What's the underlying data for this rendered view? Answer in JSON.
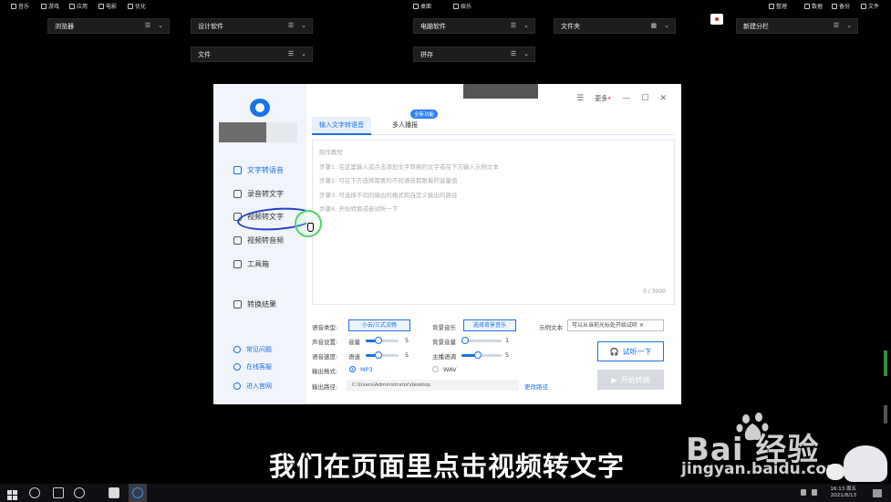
{
  "topbar": {
    "left_items": [
      "音乐",
      "游戏",
      "应用",
      "电影",
      "优化"
    ],
    "center_items": [
      "桌面",
      "娱乐"
    ],
    "right_items": [
      "整理",
      "数据",
      "备份",
      "文件"
    ]
  },
  "desktop_folders": [
    "浏览器",
    "设计软件",
    "电脑软件",
    "文件夹",
    "新建分栏",
    "文件",
    "拼存"
  ],
  "app": {
    "window": {
      "more_label": "更多",
      "dot": "•"
    },
    "sidebar": {
      "items": [
        "文字转语音",
        "录音转文字",
        "视频转文字",
        "视频转音频",
        "工具箱",
        "转换结果"
      ],
      "links": [
        "常见问题",
        "在线客服",
        "进入官网"
      ]
    },
    "tabs": [
      "输入文字转语音",
      "多人播报"
    ],
    "tab_badge": "全新功能",
    "textarea": {
      "lines": [
        "制作教程",
        "步骤1: 在这里输入或点击添加文字转换的文字或在下方输入示例文本",
        "步骤2: 可在下方选择需要的不同语音都跟着的音量值",
        "步骤3: 可选择不同的输出的格式和自定义输出的路径",
        "步骤4: 开始转换或者试听一下"
      ],
      "count": "0 / 3000"
    },
    "options": {
      "voice_type_label": "语音类型:",
      "voice_type_value": "小云/三式流畅",
      "bgm_label": "背景音乐",
      "bgm_value": "选择背景音乐",
      "example_label": "示例文本",
      "example_value": "可以从当前光标处开始试听",
      "volume_group_label": "声音设置:",
      "volume_label": "音量",
      "volume_value": "5",
      "volume_level": 0.4,
      "bg_volume_label": "背景音量",
      "bg_volume_value": "1",
      "bg_volume_level": 0.1,
      "speed_group_label": "语音速度:",
      "speed_label": "语速",
      "speed_value": "5",
      "speed_level": 0.4,
      "pitch_label": "主播语调",
      "pitch_value": "5",
      "pitch_level": 0.4,
      "format_label": "输出格式:",
      "format_mp3": "MP3",
      "format_wav": "WAV",
      "selected_format": "MP3",
      "path_label": "输出路径:",
      "path_value": "C:\\Users\\Administrator\\desktop",
      "change_path": "更改路径"
    },
    "buttons": {
      "try": "试听一下",
      "start": "开始转换"
    }
  },
  "subtitle": "我们在页面里点击视频转文字",
  "watermark": {
    "logo": "Bai  经验",
    "url": "jingyan.baidu.com"
  },
  "taskbar": {
    "time": "16:13 周五",
    "date": "2021/8/13"
  }
}
